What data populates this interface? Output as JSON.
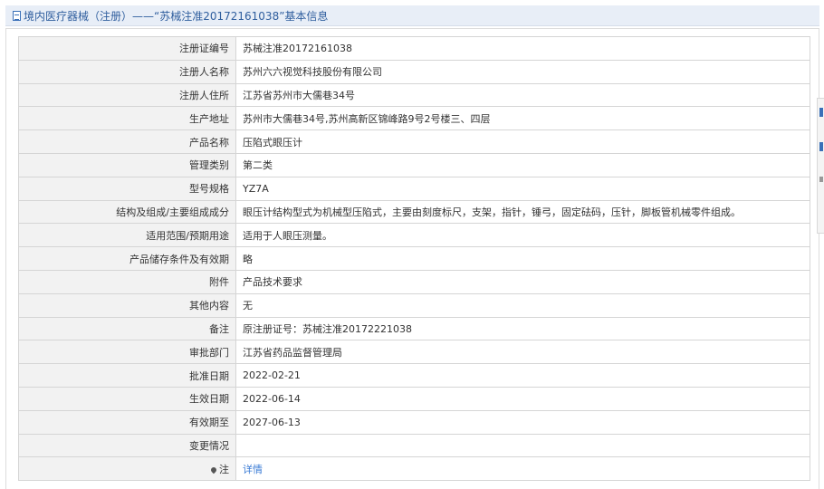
{
  "header": {
    "title": "境内医疗器械（注册）——“苏械注准20172161038”基本信息"
  },
  "rows": [
    {
      "label": "注册证编号",
      "value": "苏械注准20172161038"
    },
    {
      "label": "注册人名称",
      "value": "苏州六六视觉科技股份有限公司"
    },
    {
      "label": "注册人住所",
      "value": "江苏省苏州市大儒巷34号"
    },
    {
      "label": "生产地址",
      "value": "苏州市大儒巷34号,苏州高新区锦峰路9号2号楼三、四层"
    },
    {
      "label": "产品名称",
      "value": "压陷式眼压计"
    },
    {
      "label": "管理类别",
      "value": "第二类"
    },
    {
      "label": "型号规格",
      "value": "YZ7A"
    },
    {
      "label": "结构及组成/主要组成成分",
      "value": "眼压计结构型式为机械型压陷式，主要由刻度标尺，支架，指针，锤弓，固定砝码，压针，脚板管机械零件组成。"
    },
    {
      "label": "适用范围/预期用途",
      "value": "适用于人眼压测量。"
    },
    {
      "label": "产品储存条件及有效期",
      "value": "略"
    },
    {
      "label": "附件",
      "value": "产品技术要求"
    },
    {
      "label": "其他内容",
      "value": "无"
    },
    {
      "label": "备注",
      "value": "原注册证号：苏械注准20172221038"
    },
    {
      "label": "审批部门",
      "value": "江苏省药品监督管理局"
    },
    {
      "label": "批准日期",
      "value": "2022-02-21"
    },
    {
      "label": "生效日期",
      "value": "2022-06-14"
    },
    {
      "label": "有效期至",
      "value": "2027-06-13"
    },
    {
      "label": "变更情况",
      "value": ""
    }
  ],
  "note_row": {
    "label": "注",
    "link": "详情",
    "icon": "pin-icon"
  },
  "colors": {
    "accent": "#2f5e9e",
    "link": "#3a7bd5",
    "label_bg": "#f2f2f2",
    "header_bg": "#e8eef7"
  }
}
